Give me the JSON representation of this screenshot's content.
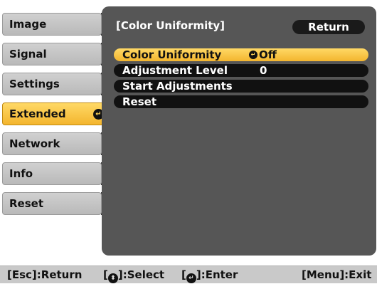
{
  "side_menu": {
    "items": [
      {
        "label": "Image"
      },
      {
        "label": "Signal"
      },
      {
        "label": "Settings"
      },
      {
        "label": "Extended"
      },
      {
        "label": "Network"
      },
      {
        "label": "Info"
      },
      {
        "label": "Reset"
      }
    ],
    "selected_index": 3
  },
  "panel": {
    "title": "[Color Uniformity]",
    "return_label": "Return",
    "options": [
      {
        "label": "Color Uniformity",
        "value": "Off"
      },
      {
        "label": "Adjustment Level",
        "value": "0"
      },
      {
        "label": "Start Adjustments",
        "value": ""
      },
      {
        "label": "Reset",
        "value": ""
      }
    ],
    "selected_index": 0
  },
  "status_bar": {
    "esc_prefix": "[Esc]",
    "esc_action": ":Return",
    "select_prefix": "[",
    "select_suffix": "]:Select",
    "enter_prefix": "[",
    "enter_suffix": "]:Enter",
    "menu_hint": "[Menu]:Exit"
  },
  "colors": {
    "accent_yellow": "#f3b52e",
    "panel_gray": "#565656",
    "tab_gray": "#c4c4c4"
  },
  "icons": [
    "enter-icon",
    "updown-arrow-icon"
  ]
}
